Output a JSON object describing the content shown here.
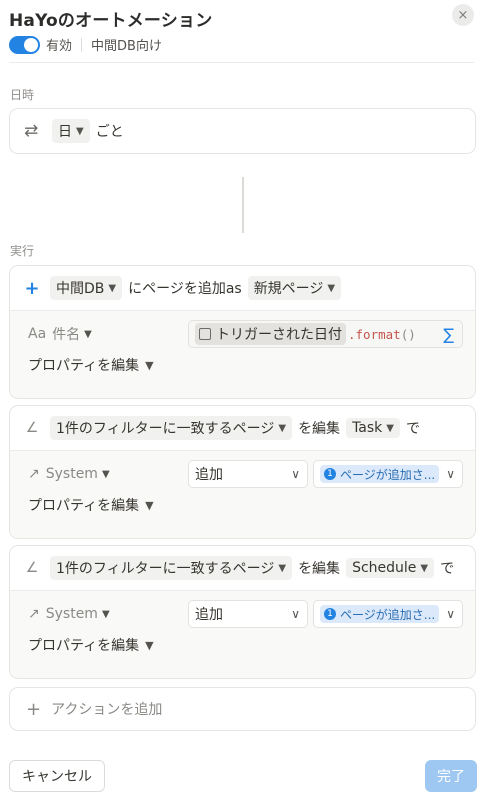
{
  "header": {
    "title": "HaYoのオートメーション",
    "status": "有効",
    "database": "中間DB向け",
    "close_icon": "×"
  },
  "trigger": {
    "section_label": "日時",
    "frequency": "日",
    "suffix": "ごと"
  },
  "actions_label": "実行",
  "action1": {
    "database": "中間DB",
    "text": "にページを追加as",
    "page_type": "新規ページ",
    "property_name": "件名",
    "property_icon": "Aa",
    "formula_token": "トリガーされた日付",
    "formula_fn": ".format",
    "formula_parens": "()",
    "edit_props": "プロパティを編集"
  },
  "action2": {
    "filter": "1件のフィルターに一致するページ",
    "text": "を編集",
    "target": "Task",
    "suffix": "で",
    "property_name": "System",
    "operation": "追加",
    "value_num": "1",
    "value": "ページが追加さ...",
    "edit_props": "プロパティを編集"
  },
  "action3": {
    "filter": "1件のフィルターに一致するページ",
    "text": "を編集",
    "target": "Schedule",
    "suffix": "で",
    "property_name": "System",
    "operation": "追加",
    "value_num": "1",
    "value": "ページが追加さ...",
    "edit_props": "プロパティを編集"
  },
  "add_action": "アクションを追加",
  "footer": {
    "cancel": "キャンセル",
    "done": "完了"
  },
  "colors": {
    "accent": "#2383e2",
    "done_disabled": "#9ec8f1",
    "formula_fn": "#c4554d"
  }
}
